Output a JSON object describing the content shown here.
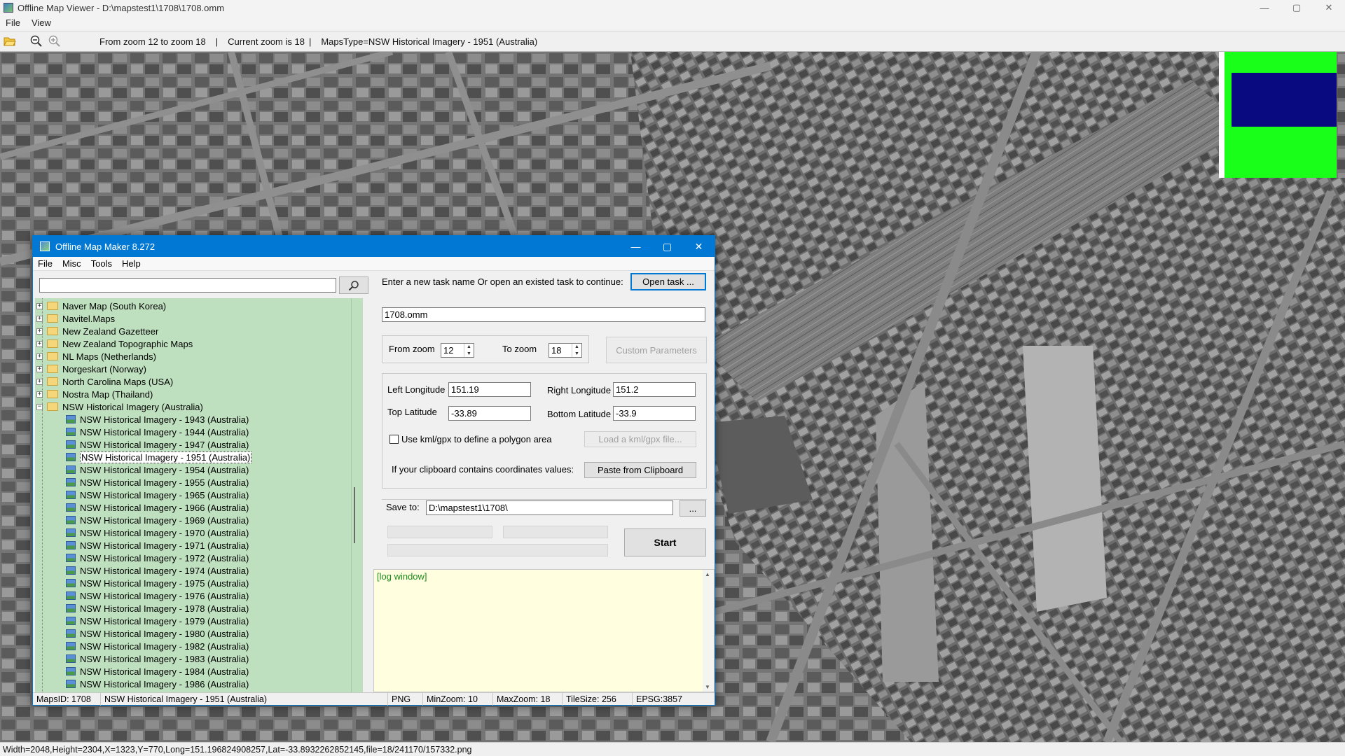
{
  "viewer": {
    "title": "Offline Map Viewer - D:\\mapstest1\\1708\\1708.omm",
    "menu": [
      "File",
      "View"
    ],
    "toolbar": {
      "zoom_range": "From zoom 12 to zoom 18",
      "separator": "|",
      "current_zoom": "Current zoom is 18",
      "maps_type": "MapsType=NSW Historical Imagery - 1951 (Australia)"
    },
    "status": "Width=2048,Height=2304,X=1323,Y=770,Long=151.196824908257,Lat=-33.8932262852145,file=18/241170/157332.png",
    "window_controls": {
      "minimize": "—",
      "maximize": "▢",
      "close": "✕"
    }
  },
  "dialog": {
    "title": "Offline Map Maker 8.272",
    "menu": [
      "File",
      "Misc",
      "Tools",
      "Help"
    ],
    "search": {
      "value": "",
      "placeholder": ""
    },
    "tree": {
      "folders": [
        "Naver Map (South Korea)",
        "Navitel.Maps",
        "New Zealand Gazetteer",
        "New Zealand Topographic Maps",
        "NL Maps (Netherlands)",
        "Norgeskart (Norway)",
        "North Carolina Maps (USA)",
        "Nostra Map (Thailand)"
      ],
      "open_folder": "NSW Historical Imagery (Australia)",
      "items": [
        "NSW Historical Imagery - 1943 (Australia)",
        "NSW Historical Imagery - 1944 (Australia)",
        "NSW Historical Imagery - 1947 (Australia)",
        "NSW Historical Imagery - 1951 (Australia)",
        "NSW Historical Imagery - 1954 (Australia)",
        "NSW Historical Imagery - 1955 (Australia)",
        "NSW Historical Imagery - 1965 (Australia)",
        "NSW Historical Imagery - 1966 (Australia)",
        "NSW Historical Imagery - 1969 (Australia)",
        "NSW Historical Imagery - 1970 (Australia)",
        "NSW Historical Imagery - 1971 (Australia)",
        "NSW Historical Imagery - 1972 (Australia)",
        "NSW Historical Imagery - 1974 (Australia)",
        "NSW Historical Imagery - 1975 (Australia)",
        "NSW Historical Imagery - 1976 (Australia)",
        "NSW Historical Imagery - 1978 (Australia)",
        "NSW Historical Imagery - 1979 (Australia)",
        "NSW Historical Imagery - 1980 (Australia)",
        "NSW Historical Imagery - 1982 (Australia)",
        "NSW Historical Imagery - 1983 (Australia)",
        "NSW Historical Imagery - 1984 (Australia)",
        "NSW Historical Imagery - 1986 (Australia)"
      ],
      "selected_index": 3
    },
    "task_prompt": "Enter a new task name Or open an existed task to continue:",
    "open_task_label": "Open task ...",
    "task_name": "1708.omm",
    "from_zoom_label": "From zoom",
    "from_zoom": "12",
    "to_zoom_label": "To zoom",
    "to_zoom": "18",
    "custom_params_label": "Custom Parameters",
    "left_lon_label": "Left Longitude",
    "left_lon": "151.19",
    "right_lon_label": "Right Longitude",
    "right_lon": "151.2",
    "top_lat_label": "Top Latitude",
    "top_lat": "-33.89",
    "bottom_lat_label": "Bottom Latitude",
    "bottom_lat": "-33.9",
    "kml_label": "Use kml/gpx to define a polygon area",
    "kml_checked": false,
    "load_kml_label": "Load a kml/gpx file...",
    "clipboard_prompt": "If your clipboard contains coordinates values:",
    "paste_label": "Paste from Clipboard",
    "save_to_label": "Save to:",
    "save_to": "D:\\mapstest1\\1708\\",
    "browse_label": "...",
    "start_label": "Start",
    "log_text": "[log window]",
    "status": {
      "maps_id": "MapsID: 1708",
      "maps_name": "NSW Historical Imagery - 1951 (Australia)",
      "format": "PNG",
      "min_zoom": "MinZoom: 10",
      "max_zoom": "MaxZoom: 18",
      "tile_size": "TileSize: 256",
      "epsg": "EPSG:3857"
    }
  },
  "icons": {
    "viewer_toolbar": [
      "folder-open-icon",
      "zoom-out-icon",
      "zoom-in-icon"
    ],
    "search": "search-icon"
  },
  "colors": {
    "titlebar_active": "#0078d4",
    "tree_bg": "#bfe0bf",
    "log_bg": "#ffffe0",
    "minimap_bg": "#19ff19",
    "minimap_viewport": "#0a0a80"
  }
}
